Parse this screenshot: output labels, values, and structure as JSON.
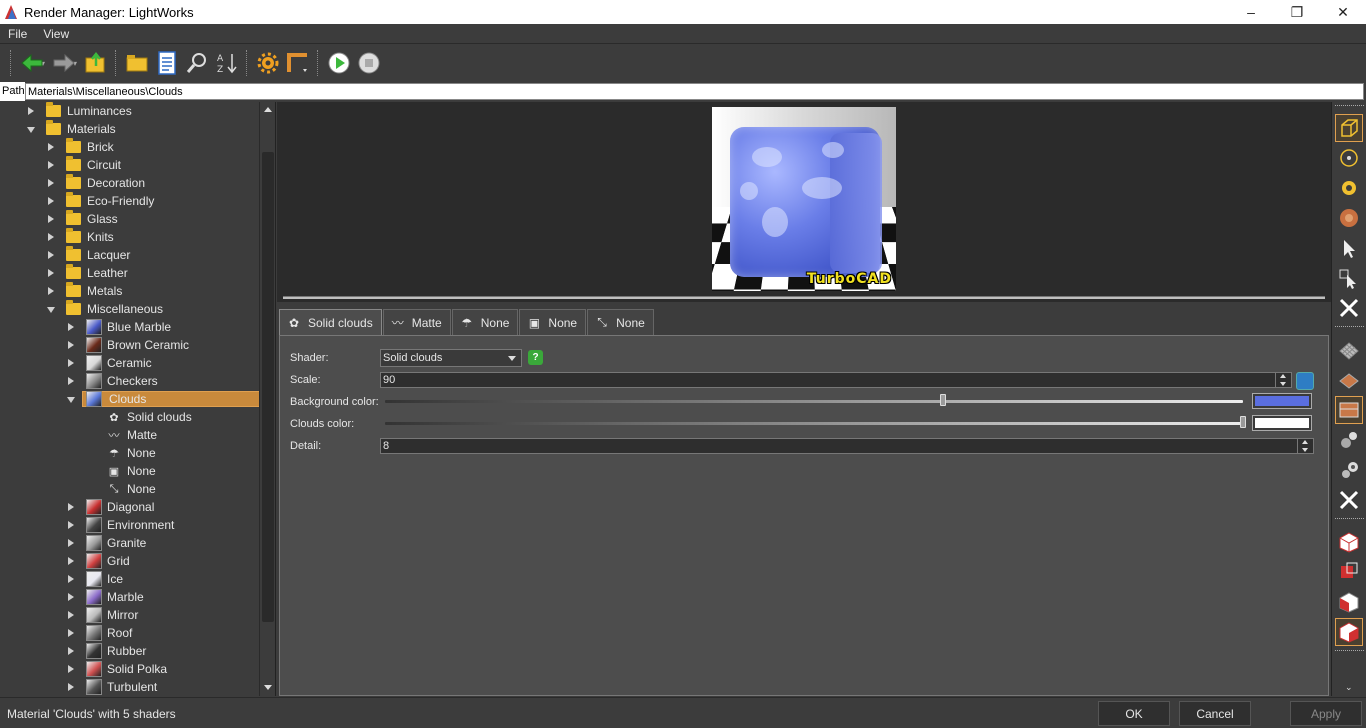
{
  "window": {
    "title": "Render Manager: LightWorks"
  },
  "menu": [
    "File",
    "View"
  ],
  "path": {
    "label": "Path",
    "value": "Materials\\Miscellaneous\\Clouds"
  },
  "tree": [
    {
      "label": "Luminances",
      "level": 1,
      "arrow": "right",
      "icon": "folder"
    },
    {
      "label": "Materials",
      "level": 1,
      "arrow": "down",
      "icon": "folder"
    },
    {
      "label": "Brick",
      "level": 2,
      "arrow": "right",
      "icon": "folder"
    },
    {
      "label": "Circuit",
      "level": 2,
      "arrow": "right",
      "icon": "folder"
    },
    {
      "label": "Decoration",
      "level": 2,
      "arrow": "right",
      "icon": "folder"
    },
    {
      "label": "Eco-Friendly",
      "level": 2,
      "arrow": "right",
      "icon": "folder"
    },
    {
      "label": "Glass",
      "level": 2,
      "arrow": "right",
      "icon": "folder"
    },
    {
      "label": "Knits",
      "level": 2,
      "arrow": "right",
      "icon": "folder"
    },
    {
      "label": "Lacquer",
      "level": 2,
      "arrow": "right",
      "icon": "folder"
    },
    {
      "label": "Leather",
      "level": 2,
      "arrow": "right",
      "icon": "folder"
    },
    {
      "label": "Metals",
      "level": 2,
      "arrow": "right",
      "icon": "folder"
    },
    {
      "label": "Miscellaneous",
      "level": 2,
      "arrow": "down",
      "icon": "folder"
    },
    {
      "label": "Blue Marble",
      "level": 3,
      "arrow": "right",
      "icon": "material",
      "color": "#4a5ac8"
    },
    {
      "label": "Brown Ceramic",
      "level": 3,
      "arrow": "right",
      "icon": "material",
      "color": "#6a2a1a"
    },
    {
      "label": "Ceramic",
      "level": 3,
      "arrow": "right",
      "icon": "material",
      "color": "#d8d8d8"
    },
    {
      "label": "Checkers",
      "level": 3,
      "arrow": "right",
      "icon": "material",
      "color": "#888888"
    },
    {
      "label": "Clouds",
      "level": 3,
      "arrow": "down",
      "icon": "material",
      "color": "#5a78d8",
      "selected": true
    },
    {
      "label": "Solid clouds",
      "level": 4,
      "arrow": "none",
      "icon": "shader",
      "glyph": "✿"
    },
    {
      "label": "Matte",
      "level": 4,
      "arrow": "none",
      "icon": "shader",
      "glyph": "〰"
    },
    {
      "label": "None",
      "level": 4,
      "arrow": "none",
      "icon": "shader",
      "glyph": "☂"
    },
    {
      "label": "None",
      "level": 4,
      "arrow": "none",
      "icon": "shader",
      "glyph": "▣"
    },
    {
      "label": "None",
      "level": 4,
      "arrow": "none",
      "icon": "shader",
      "glyph": "⤡"
    },
    {
      "label": "Diagonal",
      "level": 3,
      "arrow": "right",
      "icon": "material",
      "color": "#c83030"
    },
    {
      "label": "Environment",
      "level": 3,
      "arrow": "right",
      "icon": "material",
      "color": "#444444"
    },
    {
      "label": "Granite",
      "level": 3,
      "arrow": "right",
      "icon": "material",
      "color": "#9a9a9a"
    },
    {
      "label": "Grid",
      "level": 3,
      "arrow": "right",
      "icon": "material",
      "color": "#d04040"
    },
    {
      "label": "Ice",
      "level": 3,
      "arrow": "right",
      "icon": "material",
      "color": "#e8e8f0"
    },
    {
      "label": "Marble",
      "level": 3,
      "arrow": "right",
      "icon": "material",
      "color": "#8a6ac8"
    },
    {
      "label": "Mirror",
      "level": 3,
      "arrow": "right",
      "icon": "material",
      "color": "#bbbbbb"
    },
    {
      "label": "Roof",
      "level": 3,
      "arrow": "right",
      "icon": "material",
      "color": "#777777"
    },
    {
      "label": "Rubber",
      "level": 3,
      "arrow": "right",
      "icon": "material",
      "color": "#333333"
    },
    {
      "label": "Solid Polka",
      "level": 3,
      "arrow": "right",
      "icon": "material",
      "color": "#d05050"
    },
    {
      "label": "Turbulent",
      "level": 3,
      "arrow": "right",
      "icon": "material",
      "color": "#555555"
    }
  ],
  "preview": {
    "brand": "TurboCAD"
  },
  "tabs": [
    {
      "label": "Solid clouds",
      "icon": "solid-clouds-icon",
      "glyph": "✿"
    },
    {
      "label": "Matte",
      "icon": "matte-icon",
      "glyph": "〰"
    },
    {
      "label": "None",
      "icon": "transparency-icon",
      "glyph": "☂"
    },
    {
      "label": "None",
      "icon": "displacement-icon",
      "glyph": "▣"
    },
    {
      "label": "None",
      "icon": "mapping-icon",
      "glyph": "⤡"
    }
  ],
  "props": {
    "shader_label": "Shader:",
    "shader_value": "Solid clouds",
    "scale_label": "Scale:",
    "scale_value": "90",
    "bg_label": "Background color:",
    "bg_color": "#5a6ee0",
    "bg_slider_level": 0.65,
    "clouds_label": "Clouds color:",
    "clouds_color": "#ffffff",
    "clouds_slider_level": 1.0,
    "detail_label": "Detail:",
    "detail_value": "8"
  },
  "status": {
    "text": "Material 'Clouds' with 5 shaders",
    "ok": "OK",
    "cancel": "Cancel",
    "apply": "Apply"
  },
  "colors": {
    "accent": "#c98a3c",
    "panel": "#4d4d4d",
    "background": "#3c3c3c"
  }
}
